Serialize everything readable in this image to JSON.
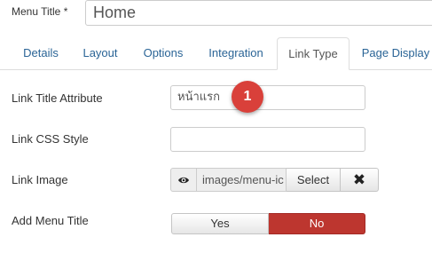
{
  "menu_title": {
    "label": "Menu Title *",
    "value": "Home"
  },
  "tabs": [
    {
      "label": "Details"
    },
    {
      "label": "Layout"
    },
    {
      "label": "Options"
    },
    {
      "label": "Integration"
    },
    {
      "label": "Link Type",
      "active": true
    },
    {
      "label": "Page Display"
    }
  ],
  "fields": {
    "link_title_attribute": {
      "label": "Link Title Attribute",
      "value": "หน้าแรก"
    },
    "link_css_style": {
      "label": "Link CSS Style",
      "value": ""
    },
    "link_image": {
      "label": "Link Image",
      "path": "images/menu-ic",
      "select_label": "Select",
      "clear_symbol": "✖"
    },
    "add_menu_title": {
      "label": "Add Menu Title",
      "yes_label": "Yes",
      "no_label": "No",
      "selected": "No"
    }
  },
  "annotation": {
    "number": "1",
    "color": "#d9403a"
  },
  "colors": {
    "tab_link": "#2a6496",
    "no_active": "#bd362f"
  }
}
